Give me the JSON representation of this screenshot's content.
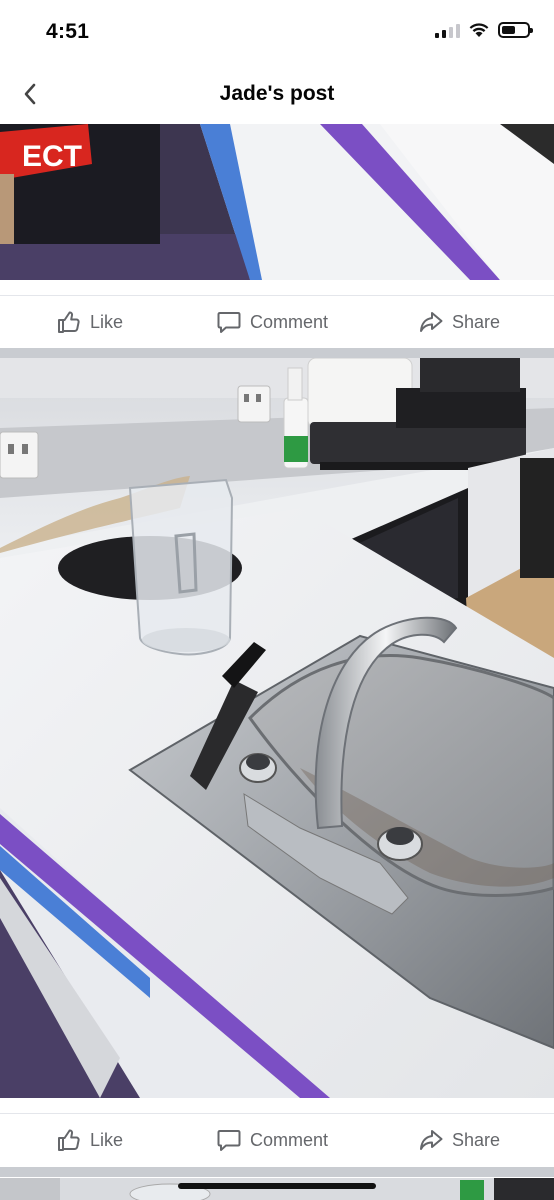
{
  "status_bar": {
    "time": "4:51"
  },
  "header": {
    "title": "Jade's post"
  },
  "posts": [
    {
      "actions": {
        "like": "Like",
        "comment": "Comment",
        "share": "Share"
      }
    },
    {
      "actions": {
        "like": "Like",
        "comment": "Comment",
        "share": "Share"
      }
    }
  ],
  "photo_1": {
    "banner_text": "ECT"
  },
  "icons": {
    "back": "chevron-left-icon",
    "like": "thumbs-up-icon",
    "comment": "speech-bubble-icon",
    "share": "share-arrow-icon"
  },
  "colors": {
    "action_text": "#65676b",
    "divider": "#c9ccd1",
    "purple_stripe": "#7b4fc4"
  }
}
